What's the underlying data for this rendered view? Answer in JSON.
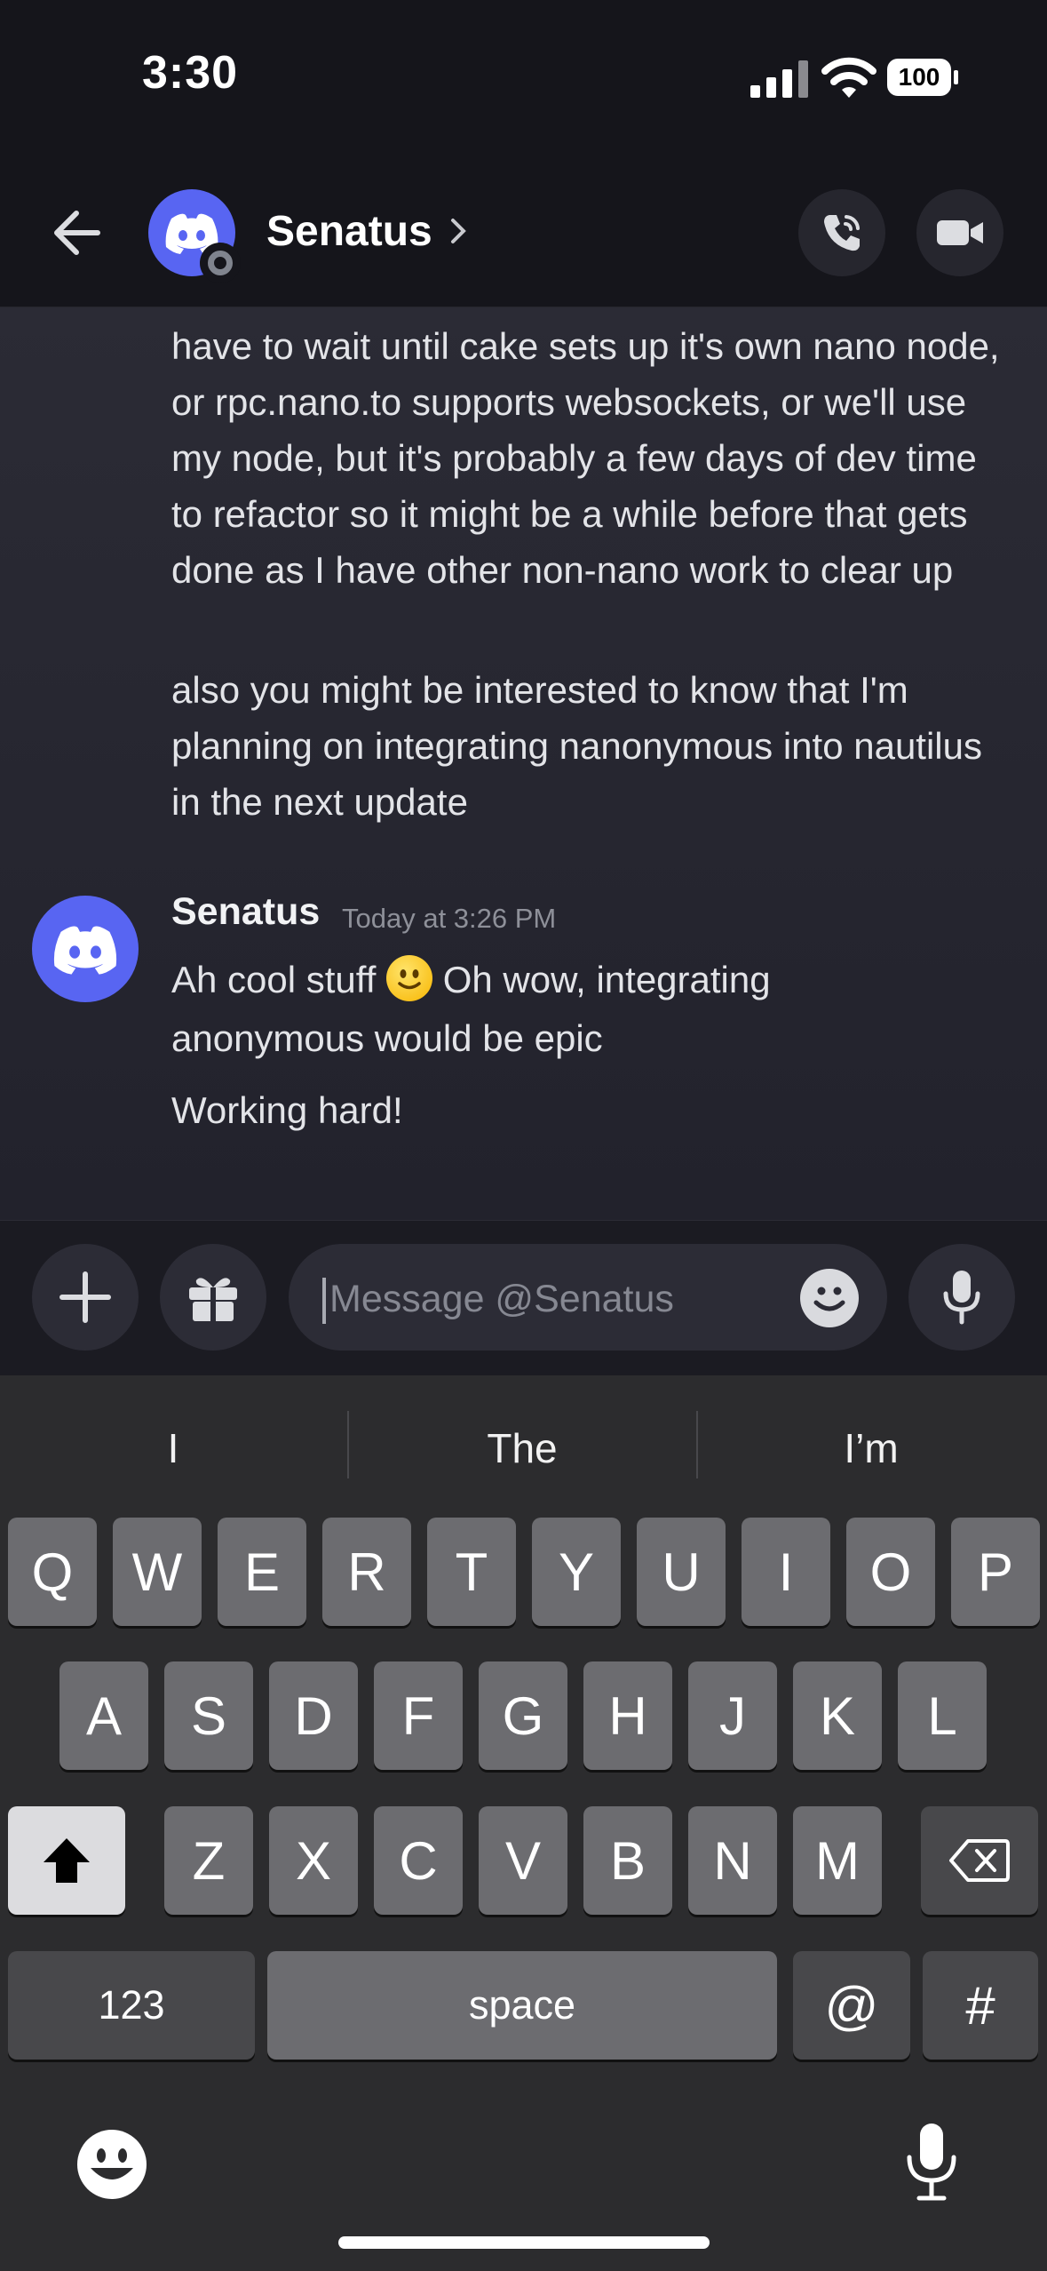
{
  "status_bar": {
    "time": "3:30",
    "battery": "100"
  },
  "header": {
    "title": "Senatus",
    "chevron": "›"
  },
  "messages": {
    "continued_1": "have to wait until cake sets up it's own nano node, or rpc.nano.to supports websockets, or we'll use my node, but it's probably a few days of dev time to refactor so it might be a while before that gets done as I have other non-nano work to clear up",
    "continued_2": "also you might be interested to know that I'm planning on integrating nanonymous into nautilus in the next update",
    "group": {
      "author": "Senatus",
      "timestamp": "Today at 3:26 PM",
      "line_1_before_emoji": "Ah cool stuff",
      "line_1_after_emoji": "Oh wow, integrating anonymous would be epic",
      "line_2": "Working hard!"
    }
  },
  "composer": {
    "placeholder": "Message @Senatus"
  },
  "keyboard": {
    "suggestions": [
      "I",
      "The",
      "I’m"
    ],
    "row1": [
      "Q",
      "W",
      "E",
      "R",
      "T",
      "Y",
      "U",
      "I",
      "O",
      "P"
    ],
    "row2": [
      "A",
      "S",
      "D",
      "F",
      "G",
      "H",
      "J",
      "K",
      "L"
    ],
    "row3": [
      "Z",
      "X",
      "C",
      "V",
      "B",
      "N",
      "M"
    ],
    "numbers_label": "123",
    "space_label": "space",
    "at_label": "@",
    "hash_label": "#"
  }
}
